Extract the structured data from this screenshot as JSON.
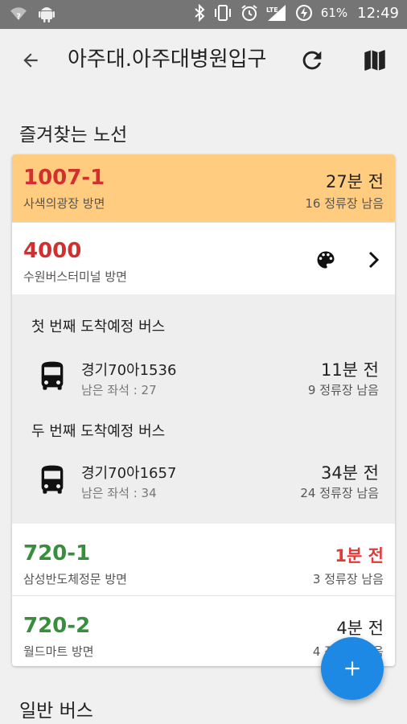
{
  "status_bar": {
    "battery": "61%",
    "time": "12:49",
    "network": "LTE",
    "icons": [
      "wifi-question-icon",
      "android-icon",
      "bluetooth-icon",
      "vibrate-icon",
      "alarm-icon",
      "signal-icon",
      "battery-charging-icon"
    ]
  },
  "toolbar": {
    "title": "아주대.아주대병원입구",
    "icons": [
      "back-arrow-icon",
      "refresh-icon",
      "map-icon"
    ]
  },
  "favorites_section": {
    "title": "즐겨찾는 노선"
  },
  "general_section": {
    "title": "일반 버스"
  },
  "routes": [
    {
      "number": "1007-1",
      "direction": "사색의광장 방면",
      "arrival": "27분 전",
      "stops_left": "16 정류장 남음",
      "number_color": "#d32f2f",
      "highlight": "#ffcc80"
    },
    {
      "number": "4000",
      "direction": "수원버스터미널 방면",
      "number_color": "#d32f2f",
      "expanded": {
        "first_label": "첫 번째 도착예정 버스",
        "first_bus": {
          "plate": "경기70아1536",
          "seats": "남은 좌석 : 27",
          "arrival": "11분 전",
          "stops_left": "9 정류장 남음"
        },
        "second_label": "두 번째 도착예정 버스",
        "second_bus": {
          "plate": "경기70아1657",
          "seats": "남은 좌석 : 34",
          "arrival": "34분 전",
          "stops_left": "24 정류장 남음"
        }
      }
    },
    {
      "number": "720-1",
      "direction": "삼성반도체정문 방면",
      "arrival": "1분 전",
      "stops_left": "3 정류장 남음",
      "number_color": "#388e3c",
      "arrival_color": "#e53935"
    },
    {
      "number": "720-2",
      "direction": "월드마트 방면",
      "arrival": "4분 전",
      "stops_left": "4 정류장 남음",
      "number_color": "#388e3c"
    }
  ],
  "fab": {
    "label": "+"
  },
  "colors": {
    "accent": "#1e88e5",
    "red_route": "#d32f2f",
    "green_route": "#388e3c",
    "favorite_highlight": "#ffcc80"
  }
}
